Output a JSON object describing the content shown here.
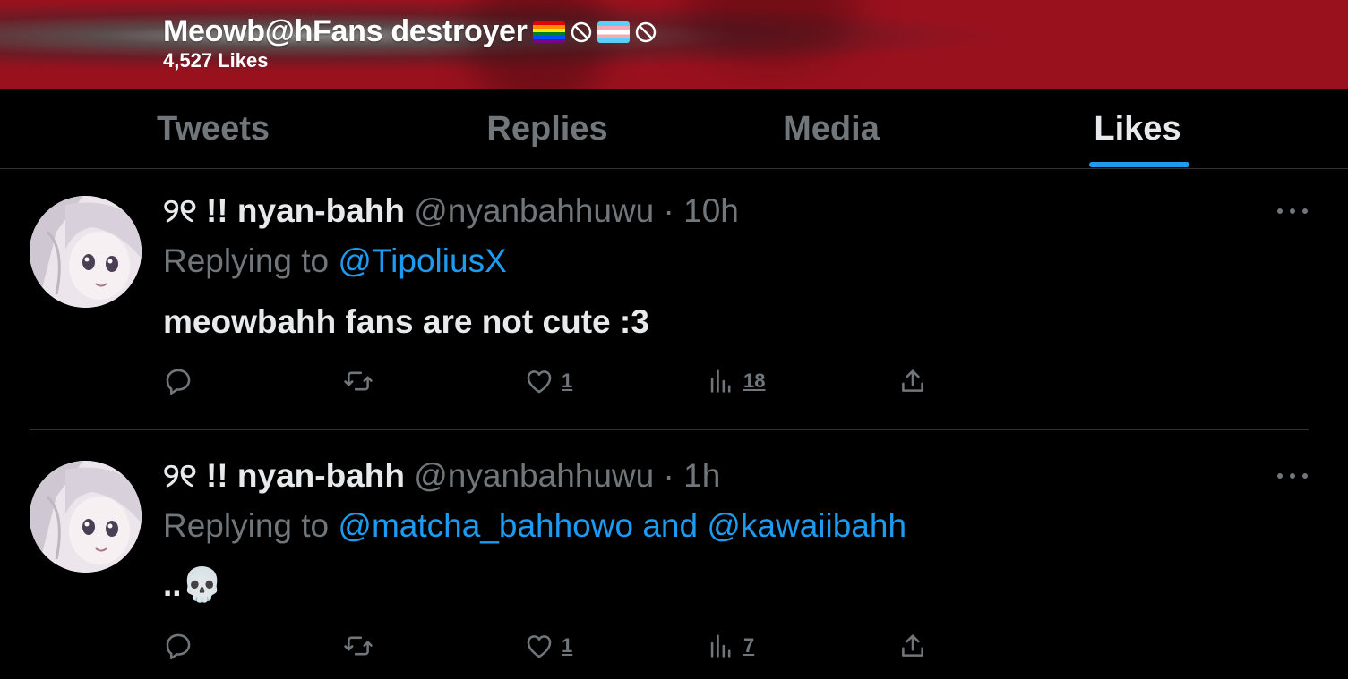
{
  "header": {
    "name": "Meowb@hFans destroyer",
    "emoji_flags": [
      "rainbow-flag-icon",
      "no-entry-icon",
      "transgender-flag-icon",
      "no-entry-icon"
    ],
    "likes_count": "4,527 Likes"
  },
  "tabs": [
    {
      "label": "Tweets",
      "active": false
    },
    {
      "label": "Replies",
      "active": false
    },
    {
      "label": "Media",
      "active": false
    },
    {
      "label": "Likes",
      "active": true
    }
  ],
  "colors": {
    "accent": "#1d9bf0",
    "header_bg": "#9a111e",
    "muted": "#71767b"
  },
  "tweets": [
    {
      "display_name": "୨୧ !! nyan-bahh",
      "handle": "@nyanbahhuwu",
      "separator": "·",
      "time": "10h",
      "replying_label": "Replying to",
      "mentions": "@TipoliusX",
      "text": "meowbahh fans are not cute :3",
      "likes": "1",
      "views": "18"
    },
    {
      "display_name": "୨୧ !! nyan-bahh",
      "handle": "@nyanbahhuwu",
      "separator": "·",
      "time": "1h",
      "replying_label": "Replying to",
      "mentions": "@matcha_bahhowo and @kawaiibahh",
      "text": "..💀",
      "likes": "1",
      "views": "7"
    }
  ]
}
